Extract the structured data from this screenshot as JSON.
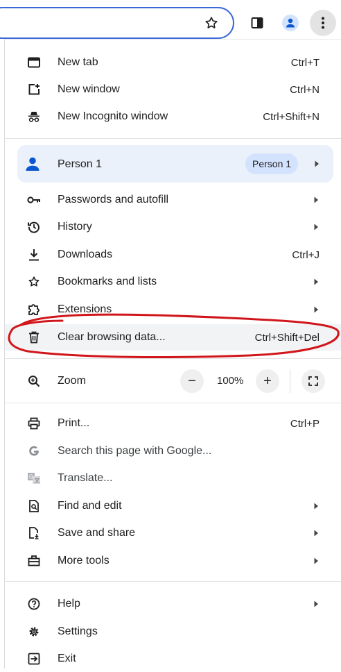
{
  "toolbar": {
    "star_icon": "star-icon",
    "side_panel_icon": "side-panel-icon",
    "profile_icon": "profile-icon",
    "menu_icon": "kebab-menu-icon"
  },
  "menu": {
    "new_tab": {
      "label": "New tab",
      "shortcut": "Ctrl+T"
    },
    "new_window": {
      "label": "New window",
      "shortcut": "Ctrl+N"
    },
    "new_incognito": {
      "label": "New Incognito window",
      "shortcut": "Ctrl+Shift+N"
    },
    "profile": {
      "label": "Person 1",
      "chip": "Person 1"
    },
    "passwords": {
      "label": "Passwords and autofill"
    },
    "history": {
      "label": "History"
    },
    "downloads": {
      "label": "Downloads",
      "shortcut": "Ctrl+J"
    },
    "bookmarks": {
      "label": "Bookmarks and lists"
    },
    "extensions": {
      "label": "Extensions"
    },
    "clear_browsing": {
      "label": "Clear browsing data...",
      "shortcut": "Ctrl+Shift+Del"
    },
    "zoom": {
      "label": "Zoom",
      "minus": "−",
      "value": "100%",
      "plus": "+"
    },
    "print": {
      "label": "Print...",
      "shortcut": "Ctrl+P"
    },
    "search_google": {
      "label": "Search this page with Google..."
    },
    "translate": {
      "label": "Translate..."
    },
    "find_edit": {
      "label": "Find and edit"
    },
    "save_share": {
      "label": "Save and share"
    },
    "more_tools": {
      "label": "More tools"
    },
    "help": {
      "label": "Help"
    },
    "settings": {
      "label": "Settings"
    },
    "exit": {
      "label": "Exit"
    }
  },
  "colors": {
    "accent": "#3b68d8",
    "profile_bg": "#eaf1fb",
    "chip_bg": "#d3e3fd",
    "annotation": "#d0161b"
  }
}
